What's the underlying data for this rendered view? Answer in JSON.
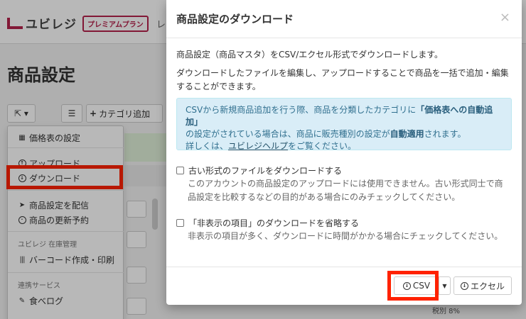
{
  "header": {
    "logo_text": "ユビレジ",
    "premium_badge": "プレミアムプラン",
    "top_cut_text": "レ"
  },
  "page": {
    "title": "商品設定"
  },
  "toolbar": {
    "category_add_label": "カテゴリ追加"
  },
  "dropdown": {
    "price_table": "価格表の設定",
    "upload": "アップロード",
    "download": "ダウンロード",
    "distribute": "商品設定を配信",
    "reservation": "商品の更新予約",
    "inventory_header": "ユビレジ 在庫管理",
    "barcode": "バーコード作成・印刷",
    "services_header": "連携サービス",
    "tabelog": "食べログ"
  },
  "background": {
    "tax_rate": "税別 8%"
  },
  "modal": {
    "title": "商品設定のダウンロード",
    "close_symbol": "×",
    "intro": "商品設定（商品マスタ）をCSV/エクセル形式でダウンロードします。",
    "edit_note": "ダウンロードしたファイルを編集し、アップロードすることで商品を一括で追加・編集することができます。",
    "info_line1_pre": "CSVから新規商品追加を行う際、商品を分類したカテゴリに",
    "info_line1_bold": "「価格表への自動追加」",
    "info_line2_pre": "の設定がされている場合は、商品に販売種別の設定が",
    "info_line2_bold": "自動適用",
    "info_line2_post": "されます。",
    "info_line3_pre": "詳しくは、",
    "info_link": "ユビレジヘルプ",
    "info_line3_post": "をご覧ください。",
    "option_old_format_label": "古い形式のファイルをダウンロードする",
    "option_old_format_help": "このアカウントの商品設定のアップロードには使用できません。古い形式同士で商品設定を比較するなどの目的がある場合にのみチェックしてください。",
    "option_skip_hidden_label": "「非表示の項目」のダウンロードを省略する",
    "option_skip_hidden_help": "非表示の項目が多く、ダウンロードに時間がかかる場合にチェックしてください。",
    "csv_button": "CSV",
    "excel_button": "エクセル"
  },
  "colors": {
    "brand": "#b5224b",
    "highlight": "#ff2200",
    "info_bg": "#d9edf7",
    "info_text": "#31708f"
  }
}
